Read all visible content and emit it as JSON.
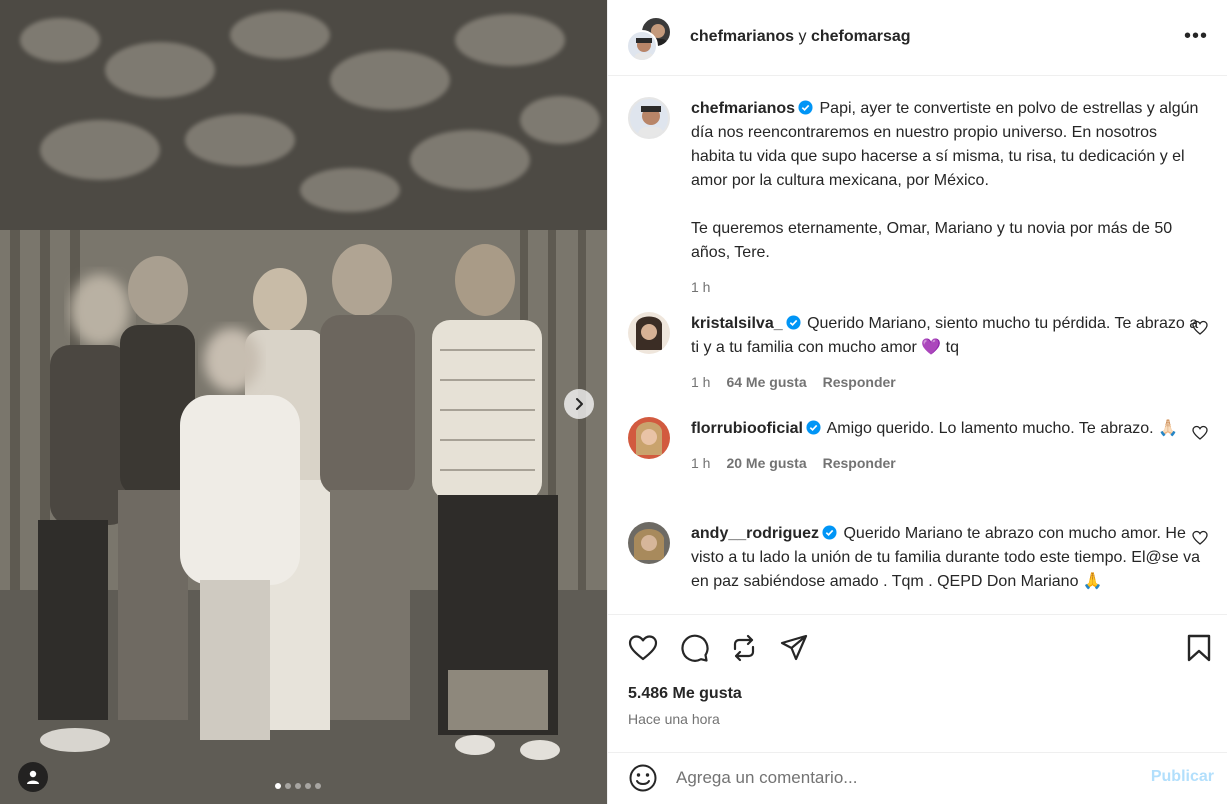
{
  "colors": {
    "verified": "#0095f6",
    "meta_text": "#737373",
    "primary_text": "#262626",
    "post_button_disabled": "#b2dffc"
  },
  "media": {
    "carousel_dots_total": 5,
    "carousel_dots_active": 1,
    "next_icon": "chevron-right-icon",
    "tag_icon": "person-tag-icon"
  },
  "header": {
    "user1": "chefmarianos",
    "connector": " y ",
    "user2": "chefomarsag",
    "more_icon": "more-options-icon",
    "more_label": "•••"
  },
  "caption": {
    "username": "chefmarianos",
    "verified": true,
    "text_p1": "Papi, ayer te convertiste en polvo de estrellas y algún día nos reencontraremos en nuestro propio universo. En nosotros habita tu vida que supo hacerse a sí misma, tu risa, tu dedicación y el amor por la cultura mexicana, por México.",
    "text_p2": "Te queremos eternamente, Omar, Mariano y tu novia por más de 50 años, Tere.",
    "time": "1 h"
  },
  "comments": [
    {
      "username": "kristalsilva_",
      "verified": true,
      "text": "Querido Mariano, siento mucho tu pérdida. Te abrazo a ti y a tu familia con mucho amor 💜 tq",
      "time": "1 h",
      "likes": "64 Me gusta",
      "reply": "Responder"
    },
    {
      "username": "florrubiooficial",
      "verified": true,
      "text": "Amigo querido. Lo lamento mucho. Te abrazo. 🙏🏻",
      "time": "1 h",
      "likes": "20 Me gusta",
      "reply": "Responder"
    },
    {
      "username": "andy__rodriguez",
      "verified": true,
      "text": "Querido Mariano te abrazo con mucho amor. He visto a tu lado la unión de tu familia durante todo este tiempo. El@se va en paz sabiéndose amado . Tqm . QEPD Don Mariano 🙏",
      "time": "",
      "likes": "",
      "reply": ""
    }
  ],
  "actions": {
    "like_icon": "heart-icon",
    "comment_icon": "comment-icon",
    "repost_icon": "repost-icon",
    "share_icon": "share-icon",
    "save_icon": "bookmark-icon",
    "likes_count": "5.486 Me gusta",
    "timestamp": "Hace una hora"
  },
  "add_comment": {
    "emoji_icon": "emoji-icon",
    "placeholder": "Agrega un comentario...",
    "post_label": "Publicar"
  }
}
